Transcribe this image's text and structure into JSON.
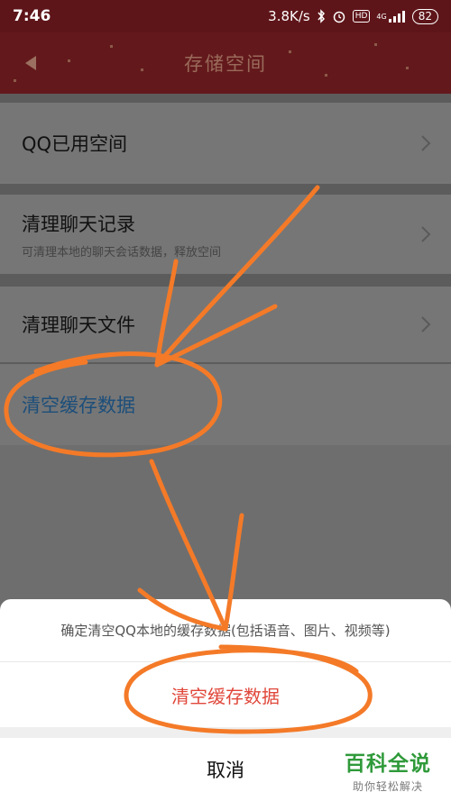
{
  "status_bar": {
    "time": "7:46",
    "speed": "3.8K/s",
    "hd": "HD",
    "network": "4G",
    "battery": "82",
    "icons": [
      "bluetooth-icon",
      "alarm-icon",
      "hd-icon",
      "signal-icon",
      "battery-icon"
    ]
  },
  "header": {
    "title": "存储空间",
    "back_icon": "back-arrow-icon"
  },
  "list": {
    "items": [
      {
        "label": "QQ已用空间"
      },
      {
        "label": "清理聊天记录",
        "sublabel": "可清理本地的聊天会话数据，释放空间"
      },
      {
        "label": "清理聊天文件"
      },
      {
        "label": "清空缓存数据"
      }
    ]
  },
  "sheet": {
    "message": "确定清空QQ本地的缓存数据(包括语音、图片、视频等)",
    "confirm_label": "清空缓存数据",
    "cancel_label": "取消"
  },
  "watermark": {
    "title": "百科全说",
    "subtitle": "助你轻松解决"
  },
  "colors": {
    "header_bg": "#63191c",
    "action_text": "#1c4e7a",
    "confirm_text": "#e0473a",
    "annotation": "#f47a28",
    "watermark": "#2f9a3a"
  }
}
